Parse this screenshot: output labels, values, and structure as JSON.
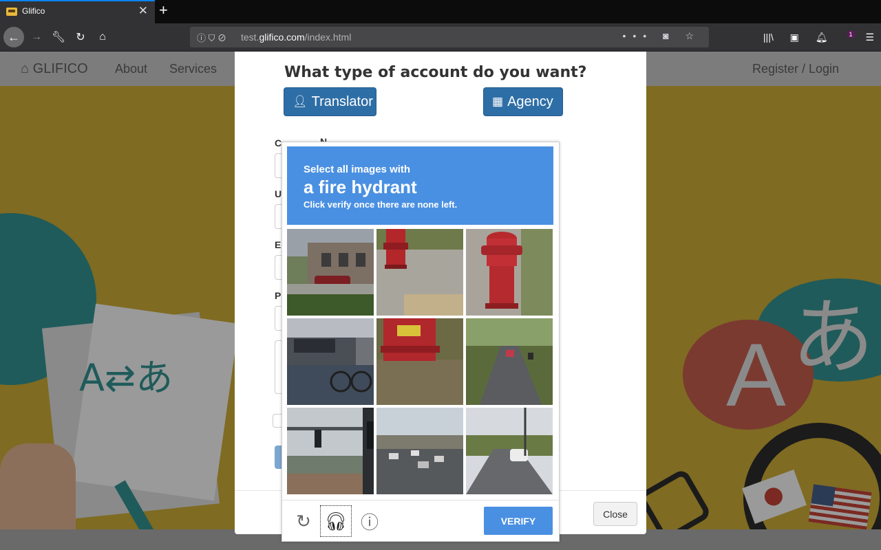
{
  "browser": {
    "tab_title": "Glifico",
    "tab_close": "✕",
    "new_tab": "+",
    "url_prefix": "test.",
    "url_domain": "glifico.com",
    "url_path": "/index.html",
    "url_actions": "••• ◙ ☆",
    "notification_count": "1"
  },
  "site": {
    "brand": "GLIFICO",
    "nav": [
      "About",
      "Services"
    ],
    "register_login": "Register / Login",
    "hero_letter_a": "A",
    "hero_letter_jp": "あ",
    "paper_text": "A⇄あ"
  },
  "modal": {
    "title": "What type of account do you want?",
    "translator_label": "Translator",
    "agency_label": "Agency",
    "field_labels": [
      "C",
      "U",
      "E",
      "P"
    ],
    "partial_label_tail": "N",
    "close_label": "Close"
  },
  "captcha": {
    "line1": "Select all images with",
    "line2": "a fire hydrant",
    "line3": "Click verify once there are none left.",
    "verify_label": "VERIFY",
    "tiles": [
      "tile-building-car",
      "tile-hydrant-base",
      "tile-red-hydrant",
      "tile-bicycle",
      "tile-hydrant-closeup",
      "tile-country-road",
      "tile-traffic-light",
      "tile-city-street",
      "tile-rural-road"
    ]
  },
  "colors": {
    "captcha_blue": "#4a90e2",
    "account_button": "#2e6ea6",
    "overlay_page": "#7f6b22"
  }
}
